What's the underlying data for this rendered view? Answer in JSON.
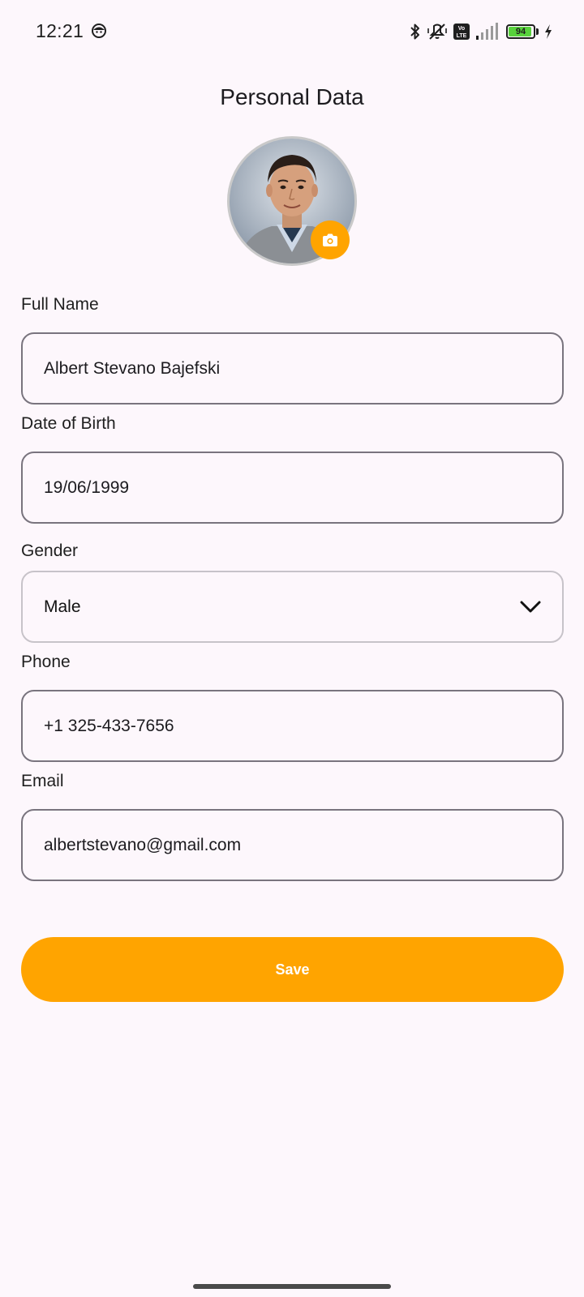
{
  "status_bar": {
    "time": "12:21",
    "battery_level": "94",
    "battery_fraction": 0.94,
    "icons": [
      "face-notification-icon",
      "bluetooth-icon",
      "vibrate-off-icon",
      "volte-icon",
      "signal-icon",
      "battery-icon",
      "charging-icon"
    ]
  },
  "header": {
    "title": "Personal Data"
  },
  "profile": {
    "avatar_icon": "avatar-photo",
    "camera_icon": "camera-icon"
  },
  "form": {
    "full_name": {
      "label": "Full Name",
      "value": "Albert Stevano Bajefski"
    },
    "dob": {
      "label": "Date of Birth",
      "value": "19/06/1999"
    },
    "gender": {
      "label": "Gender",
      "value": "Male",
      "icon": "chevron-down-icon"
    },
    "phone": {
      "label": "Phone",
      "value": "+1 325-433-7656"
    },
    "email": {
      "label": "Email",
      "value": "albertstevano@gmail.com"
    }
  },
  "actions": {
    "save_label": "Save"
  },
  "colors": {
    "accent": "#ffa400",
    "background": "#fdf7fc",
    "field_border": "#79747e"
  }
}
